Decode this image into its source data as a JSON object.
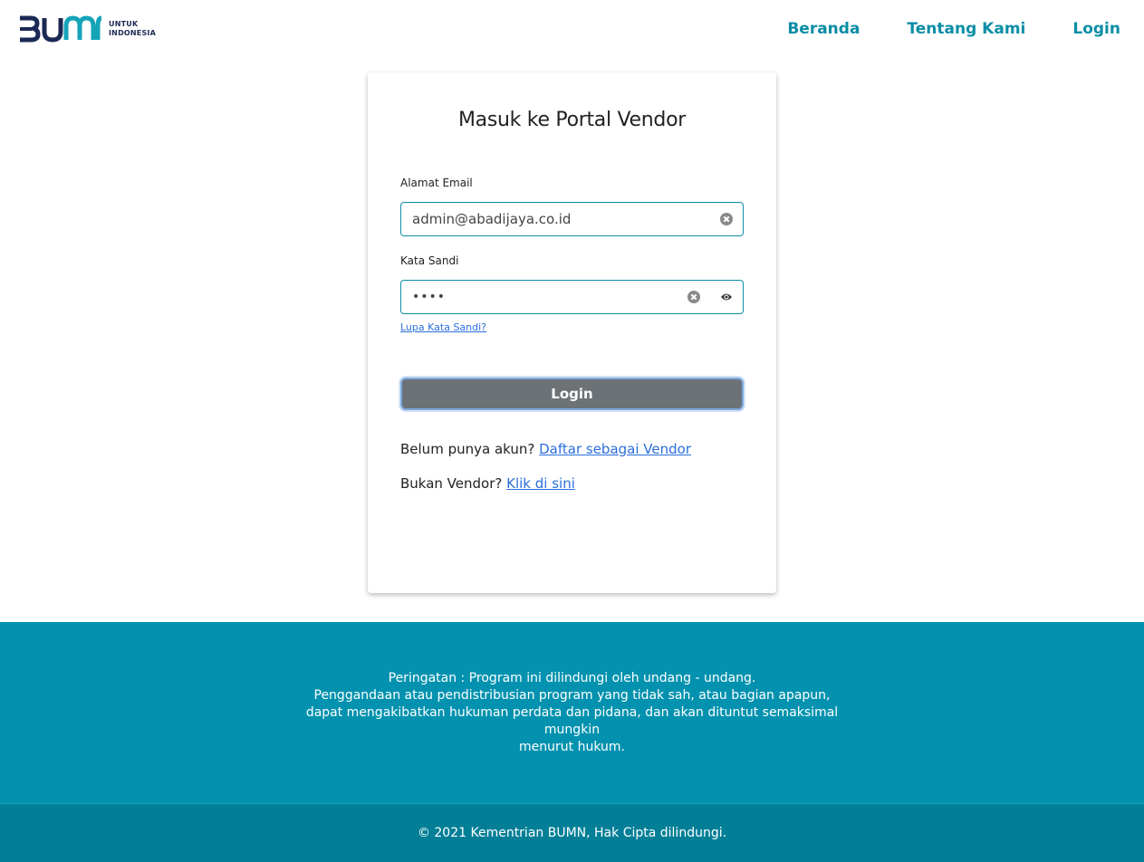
{
  "header": {
    "logo_sub_line1": "UNTUK",
    "logo_sub_line2": "INDONESIA",
    "nav": [
      {
        "label": "Beranda"
      },
      {
        "label": "Tentang Kami"
      },
      {
        "label": "Login"
      }
    ]
  },
  "colors": {
    "brand_teal": "#0292af",
    "logo_navy": "#1b2a55",
    "logo_teal": "#15a3b8",
    "button_gray": "#6c7275",
    "link_blue": "#2a6fdb"
  },
  "card": {
    "title": "Masuk ke Portal Vendor",
    "email_label": "Alamat Email",
    "email_value": "admin@abadijaya.co.id",
    "password_label": "Kata Sandi",
    "password_value": "••••",
    "forgot_label": "Lupa Kata Sandi?",
    "login_label": "Login",
    "register_prompt": "Belum punya akun?",
    "register_link": "Daftar sebagai Vendor",
    "nonvendor_prompt": "Bukan Vendor?",
    "nonvendor_link": "Klik di sini"
  },
  "footer": {
    "warning_line1": "Peringatan : Program ini dilindungi oleh undang - undang.",
    "warning_line2": "Penggandaan atau pendistribusian program yang tidak sah, atau bagian apapun,",
    "warning_line3": "dapat mengakibatkan hukuman perdata dan pidana, dan akan dituntut semaksimal mungkin",
    "warning_line4": "menurut hukum.",
    "copyright": "© 2021 Kementrian BUMN, Hak Cipta dilindungi."
  }
}
